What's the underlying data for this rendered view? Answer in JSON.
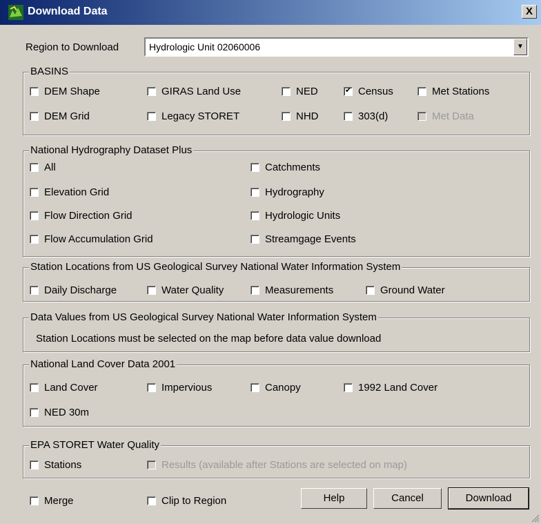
{
  "window": {
    "title": "Download Data",
    "close_label": "X"
  },
  "region": {
    "label": "Region to Download",
    "value": "Hydrologic Unit 02060006"
  },
  "basins": {
    "legend": "BASINS",
    "items": [
      {
        "label": "DEM Shape",
        "checked": false,
        "disabled": false
      },
      {
        "label": "GIRAS Land Use",
        "checked": false,
        "disabled": false
      },
      {
        "label": "NED",
        "checked": false,
        "disabled": false
      },
      {
        "label": "Census",
        "checked": true,
        "disabled": false
      },
      {
        "label": "Met Stations",
        "checked": false,
        "disabled": false
      },
      {
        "label": "DEM Grid",
        "checked": false,
        "disabled": false
      },
      {
        "label": "Legacy STORET",
        "checked": false,
        "disabled": false
      },
      {
        "label": "NHD",
        "checked": false,
        "disabled": false
      },
      {
        "label": "303(d)",
        "checked": false,
        "disabled": false
      },
      {
        "label": "Met Data",
        "checked": false,
        "disabled": true
      }
    ]
  },
  "nhdplus": {
    "legend": "National Hydrography Dataset Plus",
    "items": [
      {
        "label": "All",
        "checked": false
      },
      {
        "label": "Catchments",
        "checked": false
      },
      {
        "label": "Elevation Grid",
        "checked": false
      },
      {
        "label": "Hydrography",
        "checked": false
      },
      {
        "label": "Flow Direction Grid",
        "checked": false
      },
      {
        "label": "Hydrologic Units",
        "checked": false
      },
      {
        "label": "Flow Accumulation Grid",
        "checked": false
      },
      {
        "label": "Streamgage Events",
        "checked": false
      }
    ]
  },
  "nwis_stations": {
    "legend": "Station Locations from US Geological Survey National Water Information System",
    "items": [
      {
        "label": "Daily Discharge",
        "checked": false
      },
      {
        "label": "Water Quality",
        "checked": false
      },
      {
        "label": "Measurements",
        "checked": false
      },
      {
        "label": "Ground Water",
        "checked": false
      }
    ]
  },
  "nwis_values": {
    "legend": "Data Values from US Geological Survey National Water Information System",
    "note": "Station Locations must be selected on the map before data value download"
  },
  "nlcd": {
    "legend": "National Land Cover Data 2001",
    "items": [
      {
        "label": "Land Cover",
        "checked": false
      },
      {
        "label": "Impervious",
        "checked": false
      },
      {
        "label": "Canopy",
        "checked": false
      },
      {
        "label": "1992 Land Cover",
        "checked": false
      },
      {
        "label": "NED 30m",
        "checked": false
      }
    ]
  },
  "storet": {
    "legend": "EPA STORET Water Quality",
    "items": [
      {
        "label": "Stations",
        "checked": false,
        "disabled": false
      },
      {
        "label": "Results (available after Stations are selected on map)",
        "checked": false,
        "disabled": true
      }
    ]
  },
  "footer": {
    "merge": {
      "label": "Merge",
      "checked": false
    },
    "clip": {
      "label": "Clip to Region",
      "checked": false
    },
    "help_label": "Help",
    "cancel_label": "Cancel",
    "download_label": "Download"
  }
}
